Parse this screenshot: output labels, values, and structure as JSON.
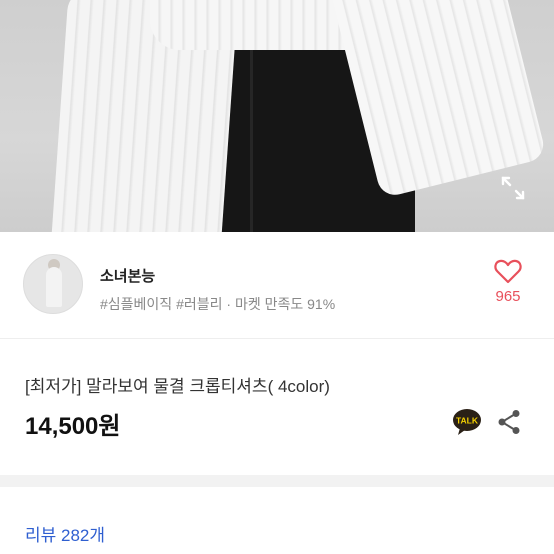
{
  "shop": {
    "name": "소녀본능",
    "tags": "#심플베이직 #러블리 · 마켓 만족도 91%",
    "likes": "965"
  },
  "product": {
    "title": "[최저가] 말라보여 물결 크롭티셔츠( 4color)",
    "price": "14,500원"
  },
  "talk_badge": "TALK",
  "reviews_label": "리뷰 282개",
  "icons": {
    "expand": "expand-icon",
    "heart": "heart-icon",
    "talk": "kakaotalk-icon",
    "share": "share-icon"
  },
  "colors": {
    "accent": "#e8505b",
    "link": "#2f5fd0",
    "talk_bg": "#2a2016",
    "talk_badge": "#f4d000"
  }
}
